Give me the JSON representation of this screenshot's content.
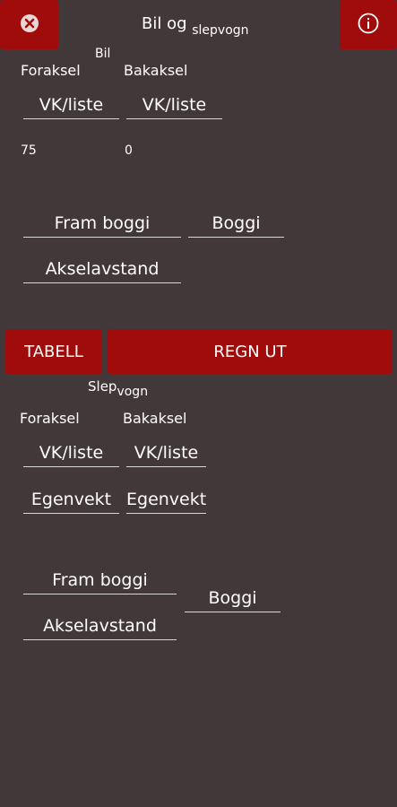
{
  "header": {
    "title_main": "Bil og ",
    "title_sub": "slepvogn"
  },
  "bil": {
    "label": "Bil",
    "foraksel_label": "Foraksel",
    "bakaksel_label": "Bakaksel",
    "foraksel_input": "VK/liste",
    "bakaksel_input": "VK/liste",
    "foraksel_value": "75",
    "bakaksel_value": "0",
    "fram_boggi": "Fram boggi",
    "boggi": "Boggi",
    "akselavstand": "Akselavstand"
  },
  "actions": {
    "tabell": "TABELL",
    "regn_ut": "REGN UT"
  },
  "slepvogn": {
    "label_main": "Slep",
    "label_sub": "vogn",
    "foraksel_label": "Foraksel",
    "bakaksel_label": "Bakaksel",
    "foraksel_input": "VK/liste",
    "bakaksel_input": "VK/liste",
    "foraksel_egenvekt": "Egenvekt",
    "bakaksel_egenvekt": "Egenvekt",
    "fram_boggi": "Fram boggi",
    "boggi": "Boggi",
    "akselavstand": "Akselavstand"
  },
  "colors": {
    "background": "#433839",
    "accent_red": "#a00b0b",
    "underline": "#d8d8d8"
  },
  "icons": {
    "close": "close-circle-icon",
    "info": "info-circle-icon"
  }
}
